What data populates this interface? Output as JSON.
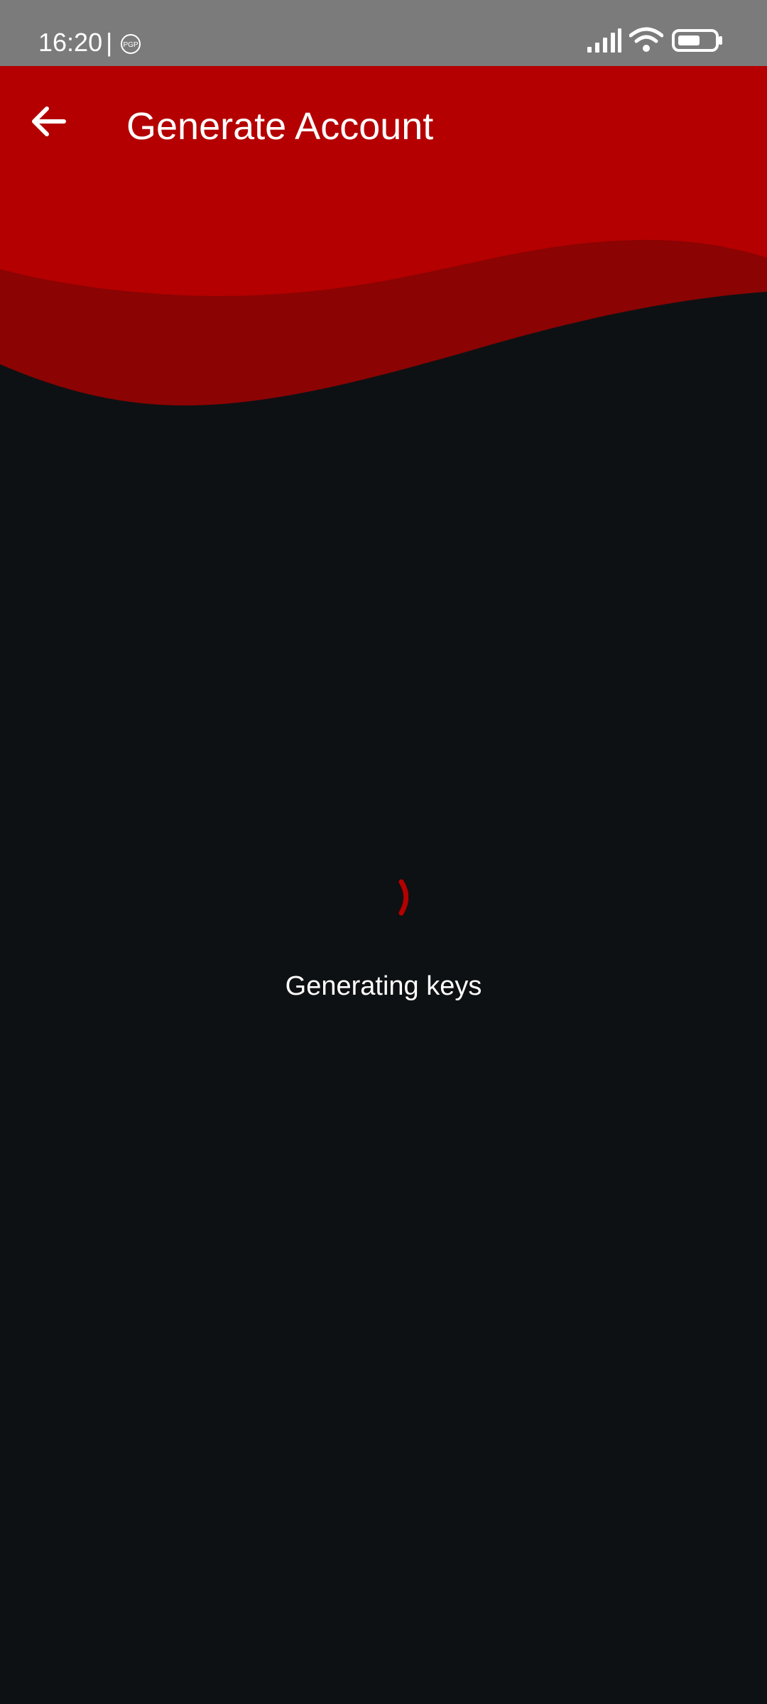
{
  "status_bar": {
    "time": "16:20",
    "separator": "|",
    "app_icon": "pgp-icon",
    "app_icon_text": "PGP",
    "icons": [
      "signal-icon",
      "wifi-icon",
      "battery-icon"
    ],
    "background_color": "#7b7b7b"
  },
  "header": {
    "title": "Generate Account",
    "back_icon": "arrow-back-icon",
    "primary_color": "#b40000",
    "secondary_color": "#8b0303"
  },
  "loading": {
    "label": "Generating keys",
    "spinner_color": "#b40000"
  },
  "colors": {
    "background": "#0e1113"
  }
}
